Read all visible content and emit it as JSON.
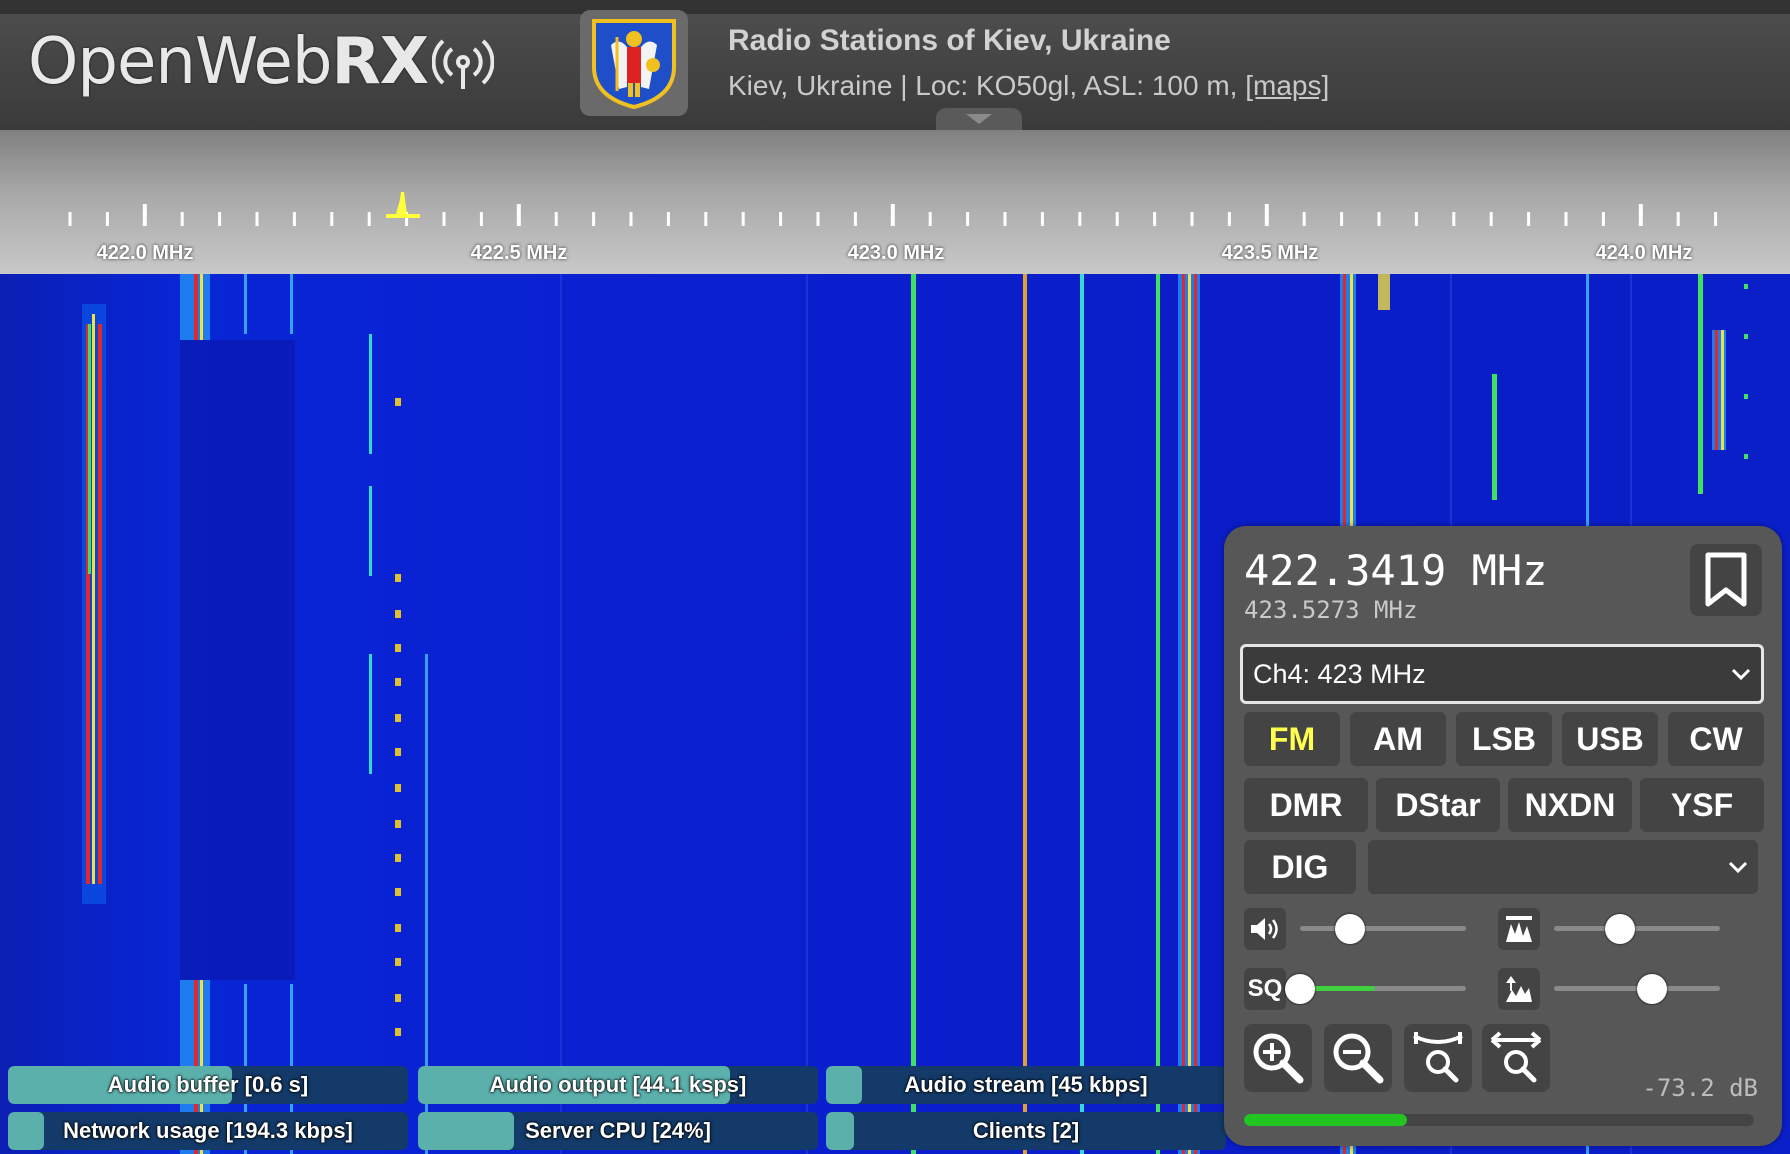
{
  "header": {
    "logo_open": "OpenWeb",
    "logo_rx": "RX",
    "receiver_name": "Radio Stations of Kiev, Ukraine",
    "receiver_location": "Kiev, Ukraine | Loc: KO50gl, ASL: 100 m, ",
    "maps_link": "[maps]",
    "avatar_icon": "coat-of-arms-icon"
  },
  "scale": {
    "labels": [
      "422.0 MHz",
      "422.5 MHz",
      "423.0 MHz",
      "423.5 MHz",
      "424.0 MHz"
    ],
    "marker_icon": "tuning-marker-icon",
    "marker_color": "#ffff3c"
  },
  "status": {
    "audio_buffer": {
      "label": "Audio buffer [0.6 s]",
      "fill": 0.56
    },
    "audio_output": {
      "label": "Audio output [44.1 ksps]",
      "fill": 0.78
    },
    "audio_stream": {
      "label": "Audio stream [45 kbps]",
      "fill": 0.09
    },
    "network_usage": {
      "label": "Network usage [194.3 kbps]",
      "fill": 0.09
    },
    "server_cpu": {
      "label": "Server CPU [24%]",
      "fill": 0.24
    },
    "clients": {
      "label": "Clients [2]",
      "fill": 0.07
    }
  },
  "panel": {
    "frequency": "422.3419 MHz",
    "offset_frequency": "423.5273 MHz",
    "bookmark_selected": "Ch4: 423 MHz",
    "modes_row1": [
      "FM",
      "AM",
      "LSB",
      "USB",
      "CW"
    ],
    "modes_row2": [
      "DMR",
      "DStar",
      "NXDN",
      "YSF"
    ],
    "dig_label": "DIG",
    "active_mode": "FM",
    "volume_level": 0.3,
    "squelch_level": 0.0,
    "squelch_signal_level": 0.45,
    "squelch_label": "SQ",
    "waterfall_max_level": 0.4,
    "waterfall_min_level": 0.59,
    "smeter_db": "-73.2 dB",
    "smeter_level": 0.32,
    "colors": {
      "active_mode": "#ffff50",
      "smeter": "#22c422",
      "panel_bg": "#575757"
    }
  }
}
